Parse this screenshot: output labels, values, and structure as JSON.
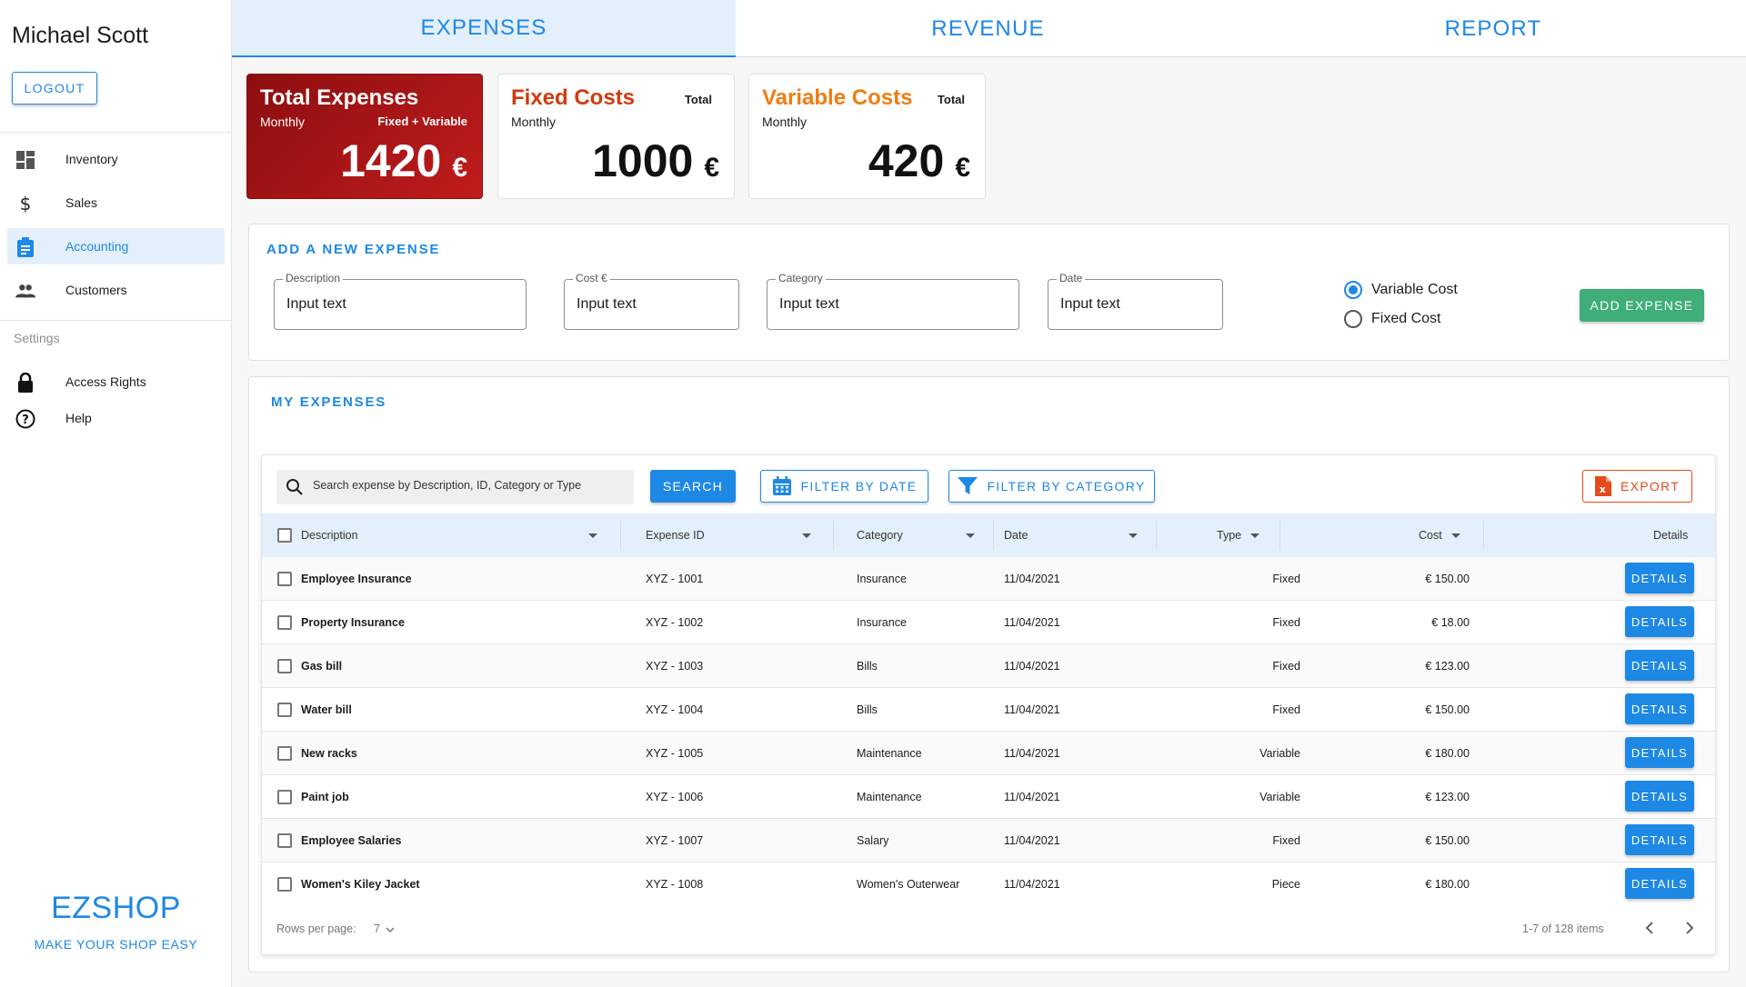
{
  "user": {
    "name": "Michael Scott"
  },
  "sidebar": {
    "logout_label": "LOGOUT",
    "items": [
      {
        "label": "Inventory",
        "icon": "dashboard-icon"
      },
      {
        "label": "Sales",
        "icon": "dollar-icon"
      },
      {
        "label": "Accounting",
        "icon": "clipboard-icon",
        "active": true
      },
      {
        "label": "Customers",
        "icon": "people-icon"
      }
    ],
    "settings_label": "Settings",
    "settings_items": [
      {
        "label": "Access Rights",
        "icon": "lock-icon"
      },
      {
        "label": "Help",
        "icon": "help-icon"
      }
    ],
    "brand_name": "EZSHOP",
    "brand_tagline": "MAKE YOUR SHOP EASY"
  },
  "tabs": [
    {
      "label": "EXPENSES",
      "active": true
    },
    {
      "label": "REVENUE",
      "active": false
    },
    {
      "label": "REPORT",
      "active": false
    }
  ],
  "cards": {
    "total": {
      "title": "Total Expenses",
      "sub": "Monthly",
      "note": "Fixed + Variable",
      "value": "1420",
      "currency": "€",
      "color": "#b01818"
    },
    "fixed": {
      "title": "Fixed Costs",
      "sub": "Monthly",
      "note": "Total",
      "value": "1000",
      "currency": "€",
      "color": "#d23a0f"
    },
    "variable": {
      "title": "Variable Costs",
      "sub": "Monthly",
      "note": "Total",
      "value": "420",
      "currency": "€",
      "color": "#f07d10"
    }
  },
  "add_expense": {
    "title": "ADD A NEW EXPENSE",
    "fields": [
      {
        "label": "Description",
        "placeholder": "Input text"
      },
      {
        "label": "Cost €",
        "placeholder": "Input text"
      },
      {
        "label": "Category",
        "placeholder": "Input text"
      },
      {
        "label": "Date",
        "placeholder": "Input text"
      }
    ],
    "radio_options": [
      {
        "label": "Variable Cost",
        "checked": true
      },
      {
        "label": "Fixed Cost",
        "checked": false
      }
    ],
    "button_label": "ADD EXPENSE"
  },
  "my_expenses": {
    "title": "MY EXPENSES",
    "search_placeholder": "Search expense by Description, ID, Category or Type",
    "search_label": "SEARCH",
    "filter_date_label": "FILTER BY DATE",
    "filter_category_label": "FILTER BY CATEGORY",
    "export_label": "EXPORT",
    "columns": [
      "Description",
      "Expense ID",
      "Category",
      "Date",
      "Type",
      "Cost",
      "Details"
    ],
    "details_label": "DETAILS",
    "rows": [
      {
        "description": "Employee Insurance",
        "id": "XYZ - 1001",
        "category": "Insurance",
        "date": "11/04/2021",
        "type": "Fixed",
        "cost": "€ 150.00"
      },
      {
        "description": "Property Insurance",
        "id": "XYZ - 1002",
        "category": "Insurance",
        "date": "11/04/2021",
        "type": "Fixed",
        "cost": "€ 18.00"
      },
      {
        "description": "Gas bill",
        "id": "XYZ - 1003",
        "category": "Bills",
        "date": "11/04/2021",
        "type": "Fixed",
        "cost": "€ 123.00"
      },
      {
        "description": "Water bill",
        "id": "XYZ - 1004",
        "category": "Bills",
        "date": "11/04/2021",
        "type": "Fixed",
        "cost": "€ 150.00"
      },
      {
        "description": "New racks",
        "id": "XYZ - 1005",
        "category": "Maintenance",
        "date": "11/04/2021",
        "type": "Variable",
        "cost": "€ 180.00"
      },
      {
        "description": "Paint job",
        "id": "XYZ - 1006",
        "category": "Maintenance",
        "date": "11/04/2021",
        "type": "Variable",
        "cost": "€ 123.00"
      },
      {
        "description": "Employee Salaries",
        "id": "XYZ - 1007",
        "category": "Salary",
        "date": "11/04/2021",
        "type": "Fixed",
        "cost": "€ 150.00"
      },
      {
        "description": "Women's Kiley Jacket",
        "id": "XYZ - 1008",
        "category": "Women's Outerwear",
        "date": "11/04/2021",
        "type": "Piece",
        "cost": "€ 180.00"
      }
    ],
    "rows_per_page_label": "Rows per page:",
    "rows_per_page_value": "7",
    "pagination_text": "1-7 of 128 items"
  },
  "colors": {
    "accent": "#1e88e5",
    "success": "#3fae79",
    "danger": "#e64a19"
  }
}
